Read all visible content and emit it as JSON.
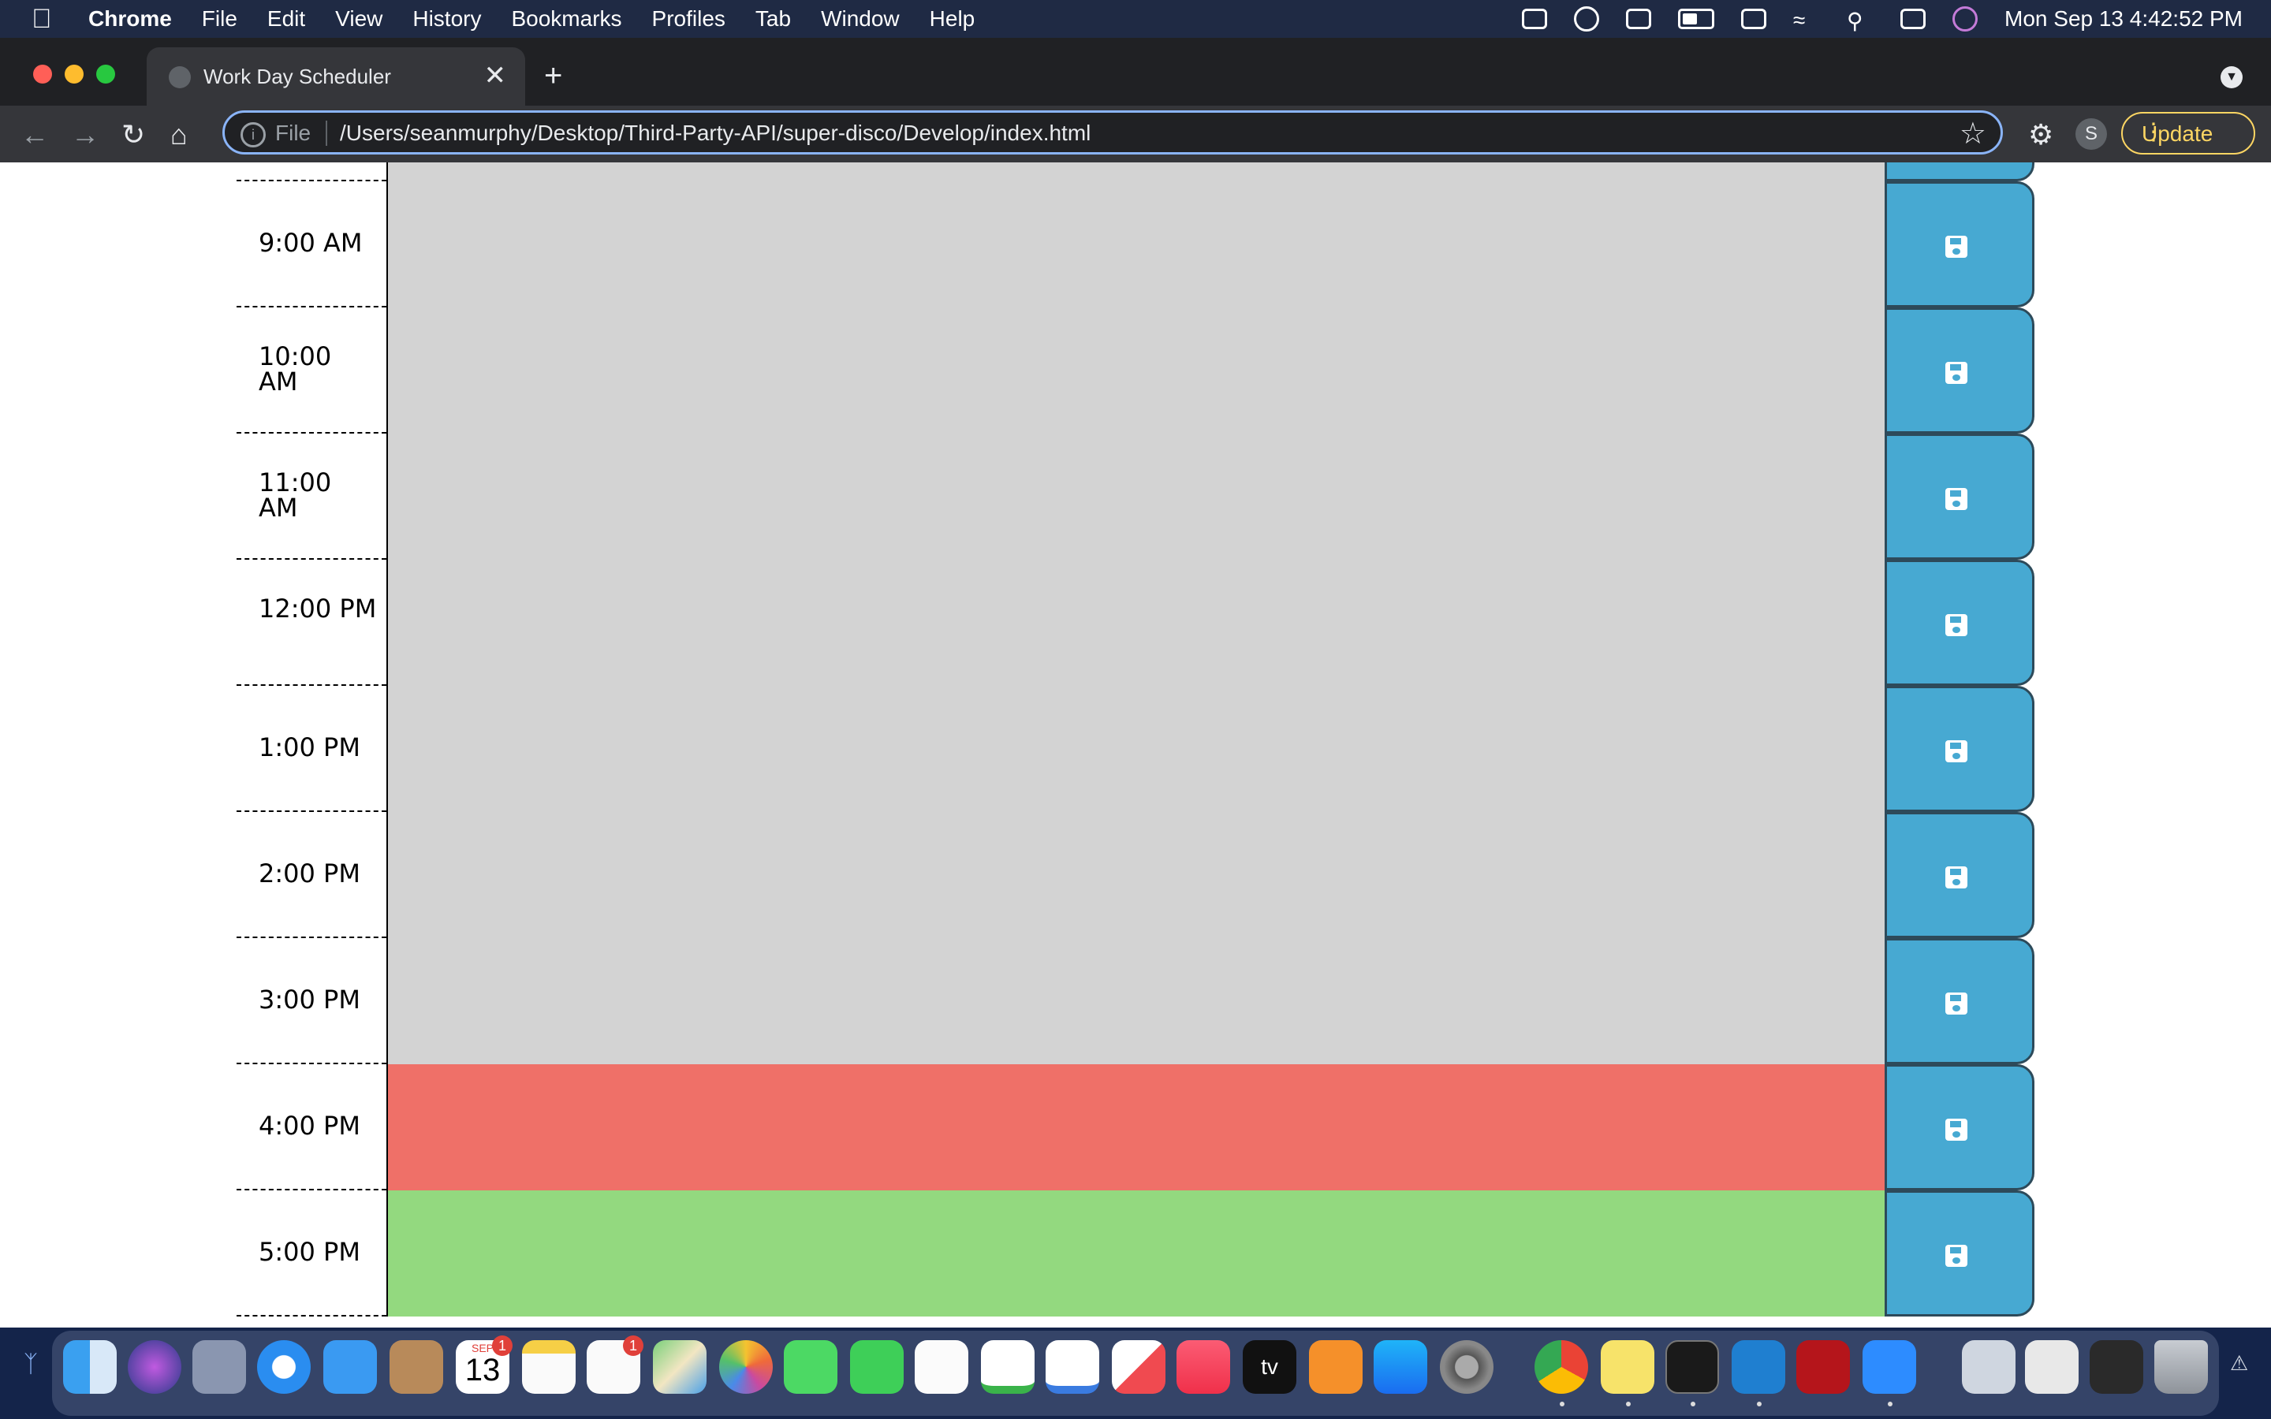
{
  "menubar": {
    "apple": "",
    "app": "Chrome",
    "items": [
      "File",
      "Edit",
      "View",
      "History",
      "Bookmarks",
      "Profiles",
      "Tab",
      "Window",
      "Help"
    ],
    "clock": "Mon Sep 13  4:42:52 PM"
  },
  "browser": {
    "tab_title": "Work Day Scheduler",
    "tab_close": "✕",
    "new_tab": "+",
    "scheme": "File",
    "url": "/Users/seanmurphy/Desktop/Third-Party-API/super-disco/Develop/index.html",
    "profile_initial": "S",
    "update_label": "Update"
  },
  "scheduler": {
    "rows": [
      {
        "hour": "9:00 AM",
        "state": "past"
      },
      {
        "hour": "10:00 AM",
        "state": "past"
      },
      {
        "hour": "11:00 AM",
        "state": "past"
      },
      {
        "hour": "12:00 PM",
        "state": "past"
      },
      {
        "hour": "1:00 PM",
        "state": "past"
      },
      {
        "hour": "2:00 PM",
        "state": "past"
      },
      {
        "hour": "3:00 PM",
        "state": "past"
      },
      {
        "hour": "4:00 PM",
        "state": "present"
      },
      {
        "hour": "5:00 PM",
        "state": "future"
      }
    ],
    "colors": {
      "past": "#d3d3d3",
      "present": "#ef7068",
      "future": "#93d97f",
      "save": "#47a9d2"
    }
  },
  "dock": {
    "calendar_month": "SEP",
    "calendar_day": "13",
    "calendar_badge": "1",
    "reminders_badge": "1",
    "tv_label": "tv"
  }
}
